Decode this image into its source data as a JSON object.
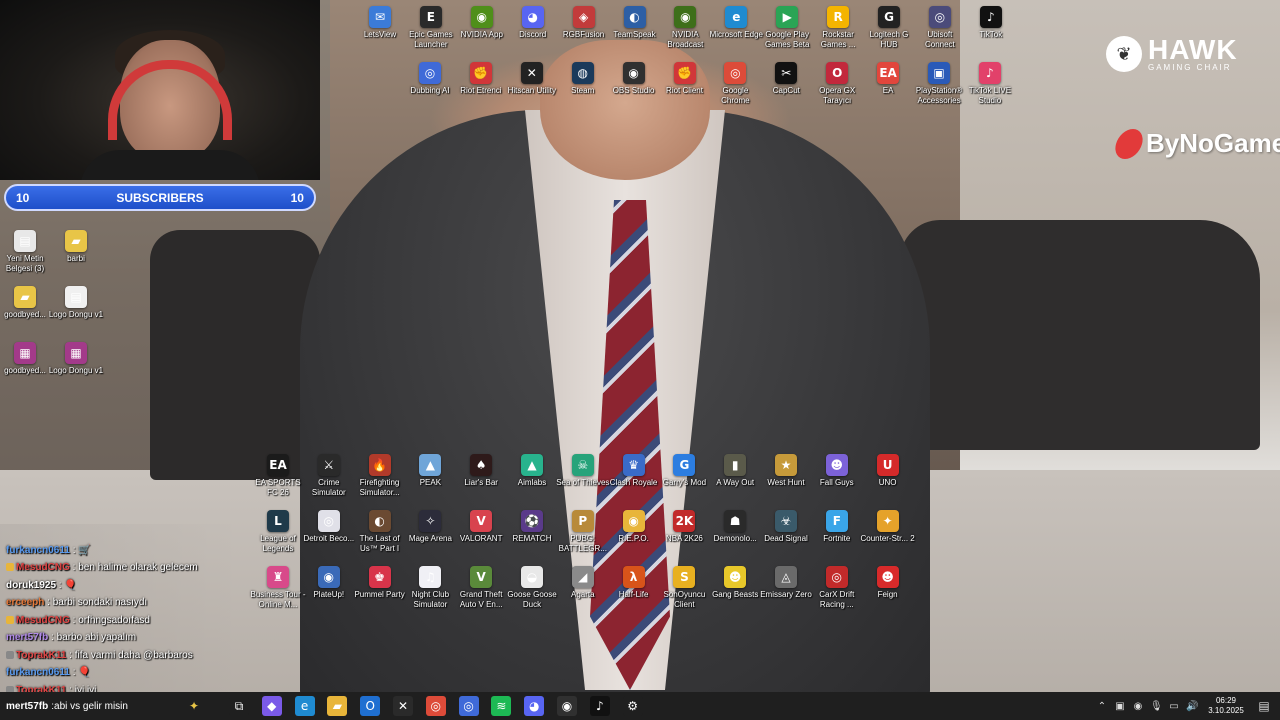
{
  "subscribers": {
    "left_count": "10",
    "label": "SUBSCRIBERS",
    "right_count": "10"
  },
  "logos": {
    "hawk_name": "HAWK",
    "hawk_sub": "GAMING CHAIR",
    "bynogame": "ByNoGame"
  },
  "desktop_top_row1": [
    {
      "label": "LetsView",
      "icon": "letsview-icon",
      "color": "#3b7bd8",
      "glyph": "✉"
    },
    {
      "label": "Epic Games Launcher",
      "icon": "epic-games-icon",
      "color": "#2a2a2a",
      "glyph": "E"
    },
    {
      "label": "NVIDIA App",
      "icon": "nvidia-icon",
      "color": "#4f8f1a",
      "glyph": "◉"
    },
    {
      "label": "Discord",
      "icon": "discord-icon",
      "color": "#5865f2",
      "glyph": "◕"
    },
    {
      "label": "RGBFusion",
      "icon": "rgbfusion-icon",
      "color": "#c23b3b",
      "glyph": "◈"
    },
    {
      "label": "TeamSpeak",
      "icon": "teamspeak-icon",
      "color": "#2d5fa5",
      "glyph": "◐"
    },
    {
      "label": "NVIDIA Broadcast",
      "icon": "nvidia-broadcast-icon",
      "color": "#3e6f1a",
      "glyph": "◉"
    },
    {
      "label": "Microsoft Edge",
      "icon": "edge-icon",
      "color": "#1f8bd1",
      "glyph": "e"
    },
    {
      "label": "Google Play Games Beta",
      "icon": "google-play-icon",
      "color": "#2aa455",
      "glyph": "▶"
    },
    {
      "label": "Rockstar Games ...",
      "icon": "rockstar-icon",
      "color": "#f4b400",
      "glyph": "R"
    },
    {
      "label": "Logitech G HUB",
      "icon": "logitech-icon",
      "color": "#222222",
      "glyph": "G"
    },
    {
      "label": "Ubisoft Connect",
      "icon": "ubisoft-icon",
      "color": "#4b4b7a",
      "glyph": "◎"
    },
    {
      "label": "TikTok",
      "icon": "tiktok-icon",
      "color": "#111111",
      "glyph": "♪"
    }
  ],
  "desktop_top_row2": [
    {
      "label": "Dubbing AI",
      "icon": "dubbing-ai-icon",
      "color": "#3f6ad8",
      "glyph": "◎"
    },
    {
      "label": "Riot Etrenci",
      "icon": "riot-icon",
      "color": "#d13639",
      "glyph": "✊"
    },
    {
      "label": "Hitscan Utility",
      "icon": "hitscan-icon",
      "color": "#222222",
      "glyph": "✕"
    },
    {
      "label": "Steam",
      "icon": "steam-icon",
      "color": "#1b3a5b",
      "glyph": "◍"
    },
    {
      "label": "OBS Studio",
      "icon": "obs-icon",
      "color": "#303030",
      "glyph": "◉"
    },
    {
      "label": "Riot Client",
      "icon": "riot-client-icon",
      "color": "#d13639",
      "glyph": "✊"
    },
    {
      "label": "Google Chrome",
      "icon": "chrome-icon",
      "color": "#dd4b39",
      "glyph": "◎"
    },
    {
      "label": "CapCut",
      "icon": "capcut-icon",
      "color": "#111111",
      "glyph": "✂"
    },
    {
      "label": "Opera GX Tarayıcı",
      "icon": "opera-gx-icon",
      "color": "#c2283c",
      "glyph": "O"
    },
    {
      "label": "EA",
      "icon": "ea-icon",
      "color": "#e2463c",
      "glyph": "EA"
    },
    {
      "label": "PlayStation® Accessories",
      "icon": "playstation-icon",
      "color": "#2a5ab8",
      "glyph": "▣"
    },
    {
      "label": "TikTok LIVE Studio",
      "icon": "tiktok-live-icon",
      "color": "#e2416a",
      "glyph": "♪"
    }
  ],
  "desktop_left": [
    {
      "label": "Yeni Metin Belgesi (3)",
      "icon": "text-document-icon",
      "color": "#e8e8e8",
      "glyph": "▤"
    },
    {
      "label": "barbi",
      "icon": "folder-icon",
      "color": "#e8c547",
      "glyph": "▰"
    },
    {
      "label": "goodbyed...",
      "icon": "folder-icon",
      "color": "#e8c547",
      "glyph": "▰"
    },
    {
      "label": "Logo Dongu v1",
      "icon": "image-file-icon",
      "color": "#f0f0f0",
      "glyph": "▤"
    },
    {
      "label": "goodbyed...",
      "icon": "winrar-icon",
      "color": "#a33a8a",
      "glyph": "▦"
    },
    {
      "label": "Logo Dongu v1",
      "icon": "winrar-icon",
      "color": "#a33a8a",
      "glyph": "▦"
    }
  ],
  "games_row1": [
    {
      "label": "EA SPORTS FC 26",
      "icon": "ea-fc-icon",
      "color": "#1b1b1b",
      "glyph": "EA"
    },
    {
      "label": "Crime Simulator",
      "icon": "crime-sim-icon",
      "color": "#2a2a2a",
      "glyph": "⚔"
    },
    {
      "label": "Firefighting Simulator...",
      "icon": "firefighting-icon",
      "color": "#b13a2a",
      "glyph": "🔥"
    },
    {
      "label": "PEAK",
      "icon": "peak-icon",
      "color": "#6fa5d8",
      "glyph": "▲"
    },
    {
      "label": "Liar's Bar",
      "icon": "liars-bar-icon",
      "color": "#2e1a1a",
      "glyph": "♠"
    },
    {
      "label": "Aimlabs",
      "icon": "aimlabs-icon",
      "color": "#28b38d",
      "glyph": "▲"
    },
    {
      "label": "Sea of Thieves",
      "icon": "sea-of-thieves-icon",
      "color": "#27a37a",
      "glyph": "☠"
    },
    {
      "label": "Clash Royale",
      "icon": "clash-royale-icon",
      "color": "#3a6bc8",
      "glyph": "♛"
    },
    {
      "label": "Garry's Mod",
      "icon": "garrys-mod-icon",
      "color": "#2c7de0",
      "glyph": "G"
    },
    {
      "label": "A Way Out",
      "icon": "a-way-out-icon",
      "color": "#5a5a4a",
      "glyph": "▮"
    },
    {
      "label": "West Hunt",
      "icon": "west-hunt-icon",
      "color": "#c69a3a",
      "glyph": "★"
    },
    {
      "label": "Fall Guys",
      "icon": "fall-guys-icon",
      "color": "#7c62d8",
      "glyph": "☻"
    },
    {
      "label": "UNO",
      "icon": "uno-icon",
      "color": "#d52a2a",
      "glyph": "U"
    }
  ],
  "games_row2": [
    {
      "label": "League of Legends",
      "icon": "league-icon",
      "color": "#1f3a4a",
      "glyph": "L"
    },
    {
      "label": "Detroit Beco...",
      "icon": "detroit-icon",
      "color": "#e0e0e8",
      "glyph": "◎"
    },
    {
      "label": "The Last of Us™ Part I",
      "icon": "last-of-us-icon",
      "color": "#6b4a32",
      "glyph": "◐"
    },
    {
      "label": "Mage Arena",
      "icon": "mage-arena-icon",
      "color": "#2c2c3a",
      "glyph": "✧"
    },
    {
      "label": "VALORANT",
      "icon": "valorant-icon",
      "color": "#d8434e",
      "glyph": "V"
    },
    {
      "label": "REMATCH",
      "icon": "rematch-icon",
      "color": "#5a3a8a",
      "glyph": "⚽"
    },
    {
      "label": "PUBG: BATTLEGR...",
      "icon": "pubg-icon",
      "color": "#b88a3a",
      "glyph": "P"
    },
    {
      "label": "R.E.P.O.",
      "icon": "repo-icon",
      "color": "#e8b53a",
      "glyph": "◉"
    },
    {
      "label": "NBA 2K26",
      "icon": "nba-2k26-icon",
      "color": "#c22a2a",
      "glyph": "2K"
    },
    {
      "label": "Demonolo...",
      "icon": "demonologist-icon",
      "color": "#2a2a2a",
      "glyph": "☗"
    },
    {
      "label": "Dead Signal",
      "icon": "dead-signal-icon",
      "color": "#3a5a6a",
      "glyph": "☣"
    },
    {
      "label": "Fortnite",
      "icon": "fortnite-icon",
      "color": "#3aa5e8",
      "glyph": "F"
    },
    {
      "label": "Counter-Str... 2",
      "icon": "cs2-icon",
      "color": "#e5a22a",
      "glyph": "✦"
    }
  ],
  "games_row3": [
    {
      "label": "Business Tour - Online M...",
      "icon": "business-tour-icon",
      "color": "#d84a8a",
      "glyph": "♜"
    },
    {
      "label": "PlateUp!",
      "icon": "plateup-icon",
      "color": "#3a6ab8",
      "glyph": "◉"
    },
    {
      "label": "Pummel Party",
      "icon": "pummel-party-icon",
      "color": "#d8344a",
      "glyph": "♚"
    },
    {
      "label": "Night Club Simulator",
      "icon": "night-club-icon",
      "color": "#f0f0f5",
      "glyph": "♫"
    },
    {
      "label": "Grand Theft Auto V En...",
      "icon": "gta-v-icon",
      "color": "#5a8a3a",
      "glyph": "V"
    },
    {
      "label": "Goose Goose Duck",
      "icon": "goose-goose-duck-icon",
      "color": "#e8e8e8",
      "glyph": "◒"
    },
    {
      "label": "Agarta",
      "icon": "agarta-icon",
      "color": "#8a8a8a",
      "glyph": "◢"
    },
    {
      "label": "Half-Life",
      "icon": "half-life-icon",
      "color": "#d8541a",
      "glyph": "λ"
    },
    {
      "label": "SonOyuncu Client",
      "icon": "sonoyuncu-icon",
      "color": "#e8b020",
      "glyph": "S"
    },
    {
      "label": "Gang Beasts",
      "icon": "gang-beasts-icon",
      "color": "#e8c82a",
      "glyph": "☻"
    },
    {
      "label": "Emissary Zero",
      "icon": "emissary-zero-icon",
      "color": "#6a6a6a",
      "glyph": "◬"
    },
    {
      "label": "CarX Drift Racing ...",
      "icon": "carx-icon",
      "color": "#c22a2a",
      "glyph": "◎"
    },
    {
      "label": "Feign",
      "icon": "feign-icon",
      "color": "#d82a2a",
      "glyph": "☻"
    }
  ],
  "chat": {
    "messages": [
      {
        "user": "furkancn0611",
        "sep": " : ",
        "text": "🛒",
        "color": "#5a9bf0",
        "badge": ""
      },
      {
        "user": "MesudCNG",
        "sep": " : ",
        "text": "ben halime olarak gelecem",
        "color": "#e04545",
        "badge": "#e8b53a"
      },
      {
        "user": "doruk1925",
        "sep": " : ",
        "text": "🎈",
        "color": "#ffffff",
        "badge": ""
      },
      {
        "user": "erceeph",
        "sep": " : ",
        "text": "barbi sondaki nasıydı",
        "color": "#e87a3a",
        "badge": ""
      },
      {
        "user": "MesudCNG",
        "sep": " : ",
        "text": "orfhngsadoıfasd",
        "color": "#e04545",
        "badge": "#e8b53a"
      },
      {
        "user": "mert57fb",
        "sep": " : ",
        "text": "barbo abi yapalım",
        "color": "#b08ae8",
        "badge": ""
      },
      {
        "user": "ToprakK11",
        "sep": " : ",
        "text": "fifa varmi daha @barbaros",
        "color": "#e04545",
        "badge": "#888888"
      },
      {
        "user": "furkancn0611",
        "sep": " : ",
        "text": "🎈",
        "color": "#5a9bf0",
        "badge": ""
      },
      {
        "user": "ToprakK11",
        "sep": " : ",
        "text": "iyi iyi",
        "color": "#e04545",
        "badge": "#888888"
      }
    ]
  },
  "taskbar": {
    "chat_user": "mert57fb",
    "chat_sep": " : ",
    "chat_text": "abi vs gelir misin",
    "time": "06:29",
    "date": "3.10.2025",
    "apps": [
      {
        "icon": "task-view-icon",
        "color": "#1f1f1f",
        "glyph": "⧉"
      },
      {
        "icon": "copilot-icon",
        "color": "#7a5ae8",
        "glyph": "◆"
      },
      {
        "icon": "edge-icon",
        "color": "#1f8bd1",
        "glyph": "e"
      },
      {
        "icon": "file-explorer-icon",
        "color": "#e8b53a",
        "glyph": "▰"
      },
      {
        "icon": "outlook-icon",
        "color": "#1f6fd1",
        "glyph": "O"
      },
      {
        "icon": "xbox-icon",
        "color": "#2a2a2a",
        "glyph": "✕"
      },
      {
        "icon": "chrome-icon",
        "color": "#dd4b39",
        "glyph": "◎"
      },
      {
        "icon": "dubbing-ai-icon",
        "color": "#3f6ad8",
        "glyph": "◎"
      },
      {
        "icon": "spotify-icon",
        "color": "#1db954",
        "glyph": "≋"
      },
      {
        "icon": "discord-icon",
        "color": "#5865f2",
        "glyph": "◕"
      },
      {
        "icon": "obs-icon",
        "color": "#303030",
        "glyph": "◉"
      },
      {
        "icon": "tiktok-icon",
        "color": "#111111",
        "glyph": "♪"
      },
      {
        "icon": "settings-icon",
        "color": "#1f1f1f",
        "glyph": "⚙"
      }
    ]
  }
}
